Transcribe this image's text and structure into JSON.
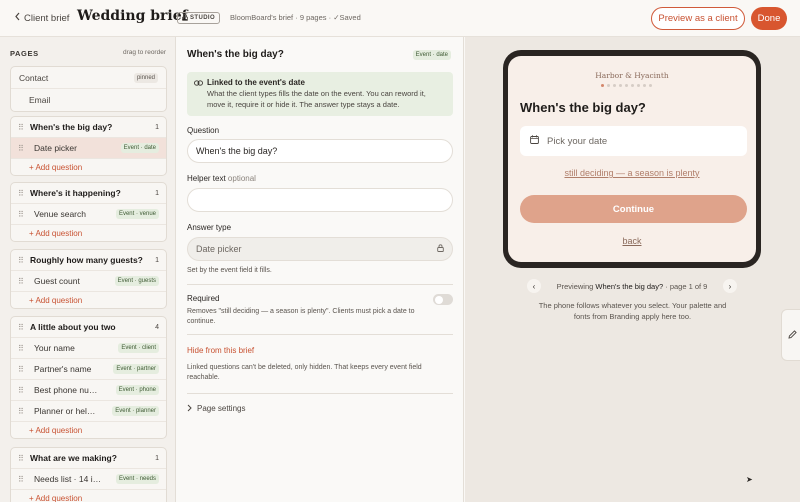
{
  "topbar": {
    "back_label": "Client brief",
    "title": "Wedding brief",
    "badge": "STUDIO",
    "meta_brief": "BloomBoard's brief",
    "meta_pages": "9 pages",
    "meta_saved": "Saved",
    "preview_label": "Preview as a client",
    "done_label": "Done"
  },
  "sidebar": {
    "heading": "PAGES",
    "drag_hint": "drag to reorder",
    "contact": {
      "label": "Contact",
      "badge": "pinned",
      "child": "Email"
    },
    "add_label": "+ Add question",
    "groups": [
      {
        "title": "When's the big day?",
        "count": "1",
        "items": [
          {
            "label": "Date picker",
            "tag": "Event · date"
          }
        ]
      },
      {
        "title": "Where's it happening?",
        "count": "1",
        "items": [
          {
            "label": "Venue search",
            "tag": "Event · venue"
          }
        ]
      },
      {
        "title": "Roughly how many guests?",
        "count": "1",
        "items": [
          {
            "label": "Guest count",
            "tag": "Event · guests"
          }
        ]
      },
      {
        "title": "A little about you two",
        "count": "4",
        "items": [
          {
            "label": "Your name",
            "tag": "Event · client"
          },
          {
            "label": "Partner's name",
            "tag": "Event · partner"
          },
          {
            "label": "Best phone nu…",
            "tag": "Event · phone"
          },
          {
            "label": "Planner or hel…",
            "tag": "Event · planner"
          }
        ]
      },
      {
        "title": "What are we making?",
        "count": "1",
        "items": [
          {
            "label": "Needs list · 14 i…",
            "tag": "Event · needs"
          }
        ]
      }
    ]
  },
  "editor": {
    "title": "When's the big day?",
    "tag": "Event · date",
    "info_title": "Linked to the event's date",
    "info_text": "What the client types fills the date on the event. You can reword it, move it, require it or hide it. The answer type stays a date.",
    "question_label": "Question",
    "question_value": "When's the big day?",
    "helper_label": "Helper text",
    "helper_optional": "optional",
    "helper_value": "",
    "answer_label": "Answer type",
    "answer_value": "Date picker",
    "answer_note": "Set by the event field it fills.",
    "required_label": "Required",
    "required_note": "Removes \"still deciding — a season is plenty\". Clients must pick a date to continue.",
    "hide_label": "Hide from this brief",
    "hide_note": "Linked questions can't be deleted, only hidden. That keeps every event field reachable.",
    "page_settings_label": "Page settings"
  },
  "preview": {
    "brand": "Harbor & Hyacinth",
    "question": "When's the big day?",
    "date_placeholder": "Pick your date",
    "deciding_link": "still deciding — a season is plenty",
    "continue_label": "Continue",
    "back_label": "back",
    "nav_prefix": "Previewing",
    "nav_page_title": "When's the big day?",
    "nav_suffix": "· page 1 of 9",
    "note": "The phone follows whatever you select. Your palette and fonts from Branding apply here too.",
    "progress_dots": 9,
    "progress_current": 1
  },
  "colors": {
    "accent": "#d8562f",
    "event_tag_bg": "#e5eddf",
    "preview_button": "#dfa38b"
  }
}
